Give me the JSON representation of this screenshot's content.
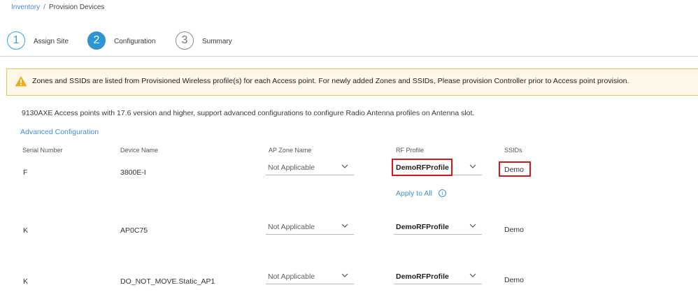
{
  "breadcrumb": {
    "parent": "Inventory",
    "separator": "/",
    "current": "Provision Devices"
  },
  "steps": [
    {
      "number": "1",
      "label": "Assign Site"
    },
    {
      "number": "2",
      "label": "Configuration"
    },
    {
      "number": "3",
      "label": "Summary"
    }
  ],
  "banner": {
    "icon": "warning-icon",
    "text": "Zones and SSIDs are listed from Provisioned Wireless profile(s) for each Access point. For newly added Zones and SSIDs, Please provision Controller prior to Access point provision."
  },
  "info_text": "9130AXE Access points with 17.6 version and higher, support advanced configurations to configure Radio Antenna profiles on Antenna slot.",
  "advanced_link": "Advanced Configuration",
  "columns": {
    "serial": "Serial Number",
    "device": "Device Name",
    "zone": "AP Zone Name",
    "rf": "RF Profile",
    "ssids": "SSIDs"
  },
  "rows": [
    {
      "serial": "F",
      "device": "3800E-I",
      "zone": "Not Applicable",
      "rf": "DemoRFProfile",
      "ssids": "Demo"
    },
    {
      "serial": "K",
      "device": "AP0C75",
      "zone": "Not Applicable",
      "rf": "DemoRFProfile",
      "ssids": "Demo"
    },
    {
      "serial": "K",
      "device": "DO_NOT_MOVE.Static_AP1",
      "zone": "Not Applicable",
      "rf": "DemoRFProfile",
      "ssids": "Demo"
    }
  ],
  "apply_to_all": "Apply to All",
  "info_icon": "i",
  "colors": {
    "accent": "#2b96d2",
    "link": "#3f8fd0",
    "warning_border": "#f2c14a",
    "warning_bg": "#fdf7e9",
    "highlight": "#d9161c"
  }
}
